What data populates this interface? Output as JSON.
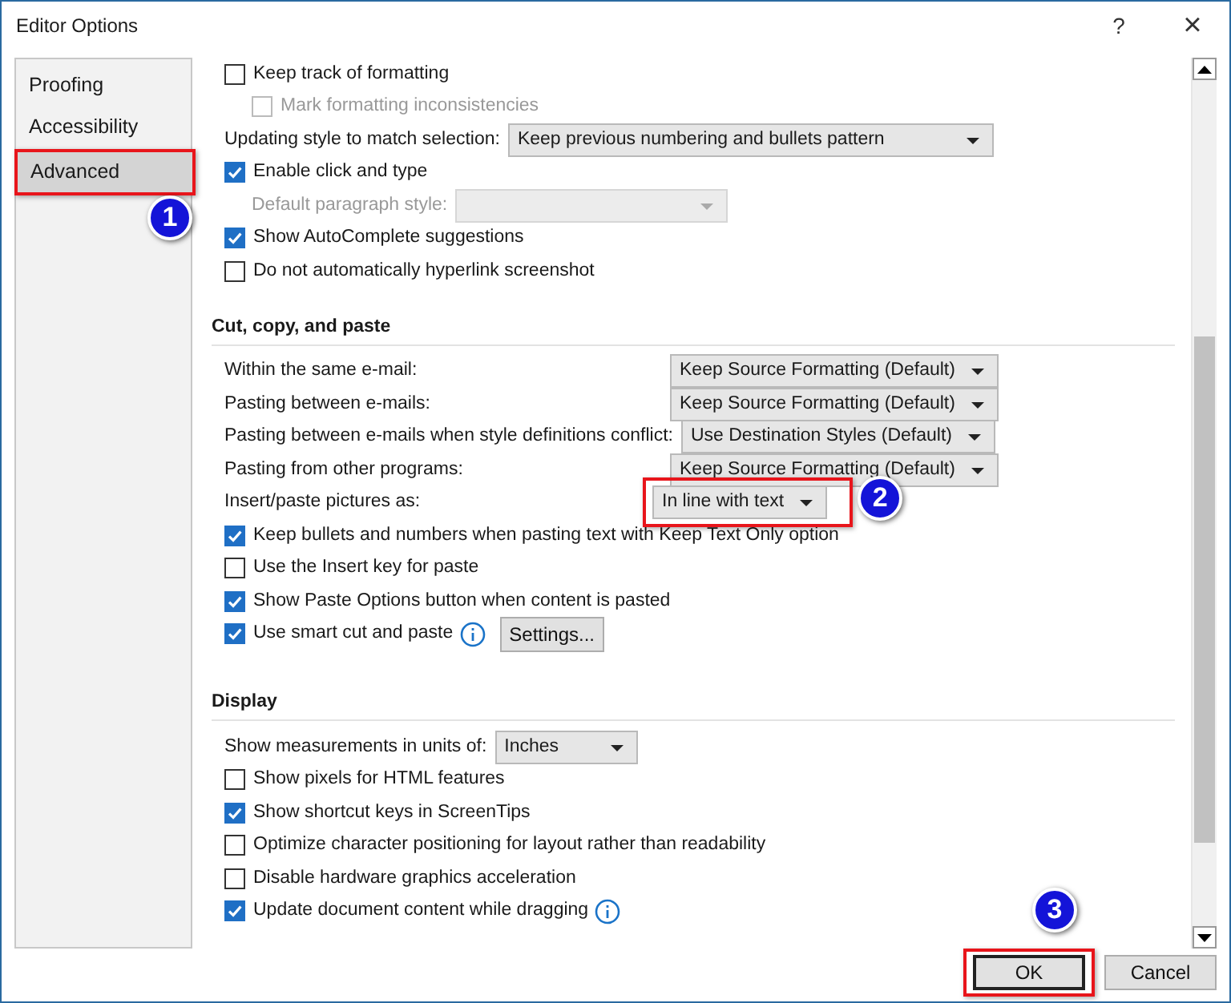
{
  "window": {
    "title": "Editor Options",
    "help": "?",
    "close": "×"
  },
  "sidebar": {
    "items": [
      {
        "label": "Proofing",
        "selected": false
      },
      {
        "label": "Accessibility",
        "selected": false
      },
      {
        "label": "Advanced",
        "selected": true,
        "callout": "1"
      }
    ]
  },
  "sections": [
    {
      "rows": [
        {
          "kind": "checkbox",
          "label": "Keep track of formatting",
          "checked": false,
          "disabled": false,
          "children": [
            {
              "kind": "checkbox",
              "label": "Mark formatting inconsistencies",
              "checked": false,
              "disabled": true
            }
          ]
        },
        {
          "kind": "dropdown",
          "label": "Updating style to match selection:",
          "value": "Keep previous numbering and bullets pattern",
          "disabled": false
        },
        {
          "kind": "checkbox",
          "label": "Enable click and type",
          "checked": true,
          "disabled": false,
          "children": [
            {
              "kind": "dropdown",
              "label": "Default paragraph style:",
              "disabled": true
            }
          ]
        },
        {
          "kind": "checkbox",
          "label": "Show AutoComplete suggestions",
          "checked": true,
          "disabled": false
        },
        {
          "kind": "checkbox",
          "label": "Do not automatically hyperlink screenshot",
          "checked": false,
          "disabled": false
        }
      ]
    },
    {
      "heading": "Cut, copy, and paste",
      "rows": [
        {
          "kind": "dropdown",
          "label": "Within the same e-mail:",
          "value": "Keep Source Formatting (Default)",
          "disabled": false
        },
        {
          "kind": "dropdown",
          "label": "Pasting between e-mails:",
          "value": "Keep Source Formatting (Default)",
          "disabled": false
        },
        {
          "kind": "dropdown",
          "label": "Pasting between e-mails when style definitions conflict:",
          "value": "Use Destination Styles (Default)",
          "disabled": false
        },
        {
          "kind": "dropdown",
          "label": "Pasting from other programs:",
          "value": "Keep Source Formatting (Default)",
          "disabled": false
        },
        {
          "kind": "dropdown",
          "label": "Insert/paste pictures as:",
          "value": "In line with text",
          "disabled": false,
          "callout": "2"
        },
        {
          "kind": "checkbox",
          "label": "Keep bullets and numbers when pasting text with Keep Text Only option",
          "checked": true,
          "disabled": false
        },
        {
          "kind": "checkbox",
          "label": "Use the Insert key for paste",
          "checked": false,
          "disabled": false
        },
        {
          "kind": "checkbox",
          "label": "Show Paste Options button when content is pasted",
          "checked": true,
          "disabled": false
        },
        {
          "kind": "checkbox",
          "label": "Use smart cut and paste",
          "checked": true,
          "disabled": false,
          "info": true,
          "button": "Settings..."
        }
      ]
    },
    {
      "heading": "Display",
      "rows": [
        {
          "kind": "dropdown",
          "label": "Show measurements in units of:",
          "value": "Inches",
          "disabled": false
        },
        {
          "kind": "checkbox",
          "label": "Show pixels for HTML features",
          "checked": false,
          "disabled": false
        },
        {
          "kind": "checkbox",
          "label": "Show shortcut keys in ScreenTips",
          "checked": true,
          "disabled": false
        },
        {
          "kind": "checkbox",
          "label": "Optimize character positioning for layout rather than readability",
          "checked": false,
          "disabled": false
        },
        {
          "kind": "checkbox",
          "label": "Disable hardware graphics acceleration",
          "checked": false,
          "disabled": false
        },
        {
          "kind": "checkbox",
          "label": "Update document content while dragging",
          "checked": true,
          "disabled": false,
          "info": true
        }
      ]
    }
  ],
  "buttons": [
    {
      "label": "OK",
      "default": true,
      "callout": "3"
    },
    {
      "label": "Cancel",
      "default": false
    }
  ]
}
